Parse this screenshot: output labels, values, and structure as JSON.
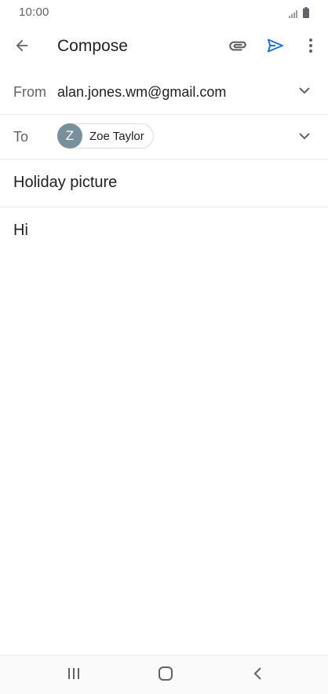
{
  "status_bar": {
    "time": "10:00",
    "icons": [
      "signal-icon",
      "battery-icon"
    ]
  },
  "app_bar": {
    "title": "Compose",
    "icons": [
      "back-arrow-icon",
      "attach-icon",
      "send-icon",
      "more-vert-icon"
    ],
    "accent_color": "#1a73e8"
  },
  "from": {
    "label": "From",
    "value": "alan.jones.wm@gmail.com"
  },
  "to": {
    "label": "To",
    "recipient": {
      "initial": "Z",
      "name": "Zoe Taylor",
      "avatar_color": "#78909c"
    }
  },
  "subject": {
    "value": "Holiday picture"
  },
  "body": {
    "value": "Hi"
  },
  "nav_bar": {
    "icons": [
      "recents-icon",
      "home-icon",
      "nav-back-icon"
    ]
  }
}
